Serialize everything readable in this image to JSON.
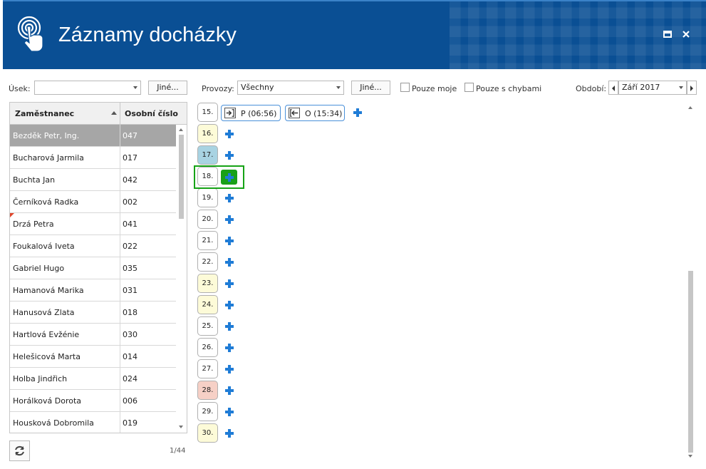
{
  "window": {
    "title": "Záznamy docházky"
  },
  "filters": {
    "usek_label": "Úsek:",
    "usek_value": "",
    "usek_other": "Jiné...",
    "provozy_label": "Provozy:",
    "provozy_value": "Všechny",
    "provozy_other": "Jiné...",
    "only_mine": "Pouze moje",
    "only_errors": "Pouze s chybami",
    "obdobi_label": "Období:",
    "obdobi_value": "Září 2017"
  },
  "grid": {
    "col_employee": "Zaměstnanec",
    "col_number": "Osobní číslo",
    "rows": [
      {
        "name": "Bezděk Petr, Ing.",
        "number": "047",
        "selected": true,
        "flag": false
      },
      {
        "name": "Bucharová Jarmila",
        "number": "017",
        "selected": false,
        "flag": false
      },
      {
        "name": "Buchta Jan",
        "number": "042",
        "selected": false,
        "flag": false
      },
      {
        "name": "Černíková Radka",
        "number": "002",
        "selected": false,
        "flag": false
      },
      {
        "name": "Drzá Petra",
        "number": "041",
        "selected": false,
        "flag": true
      },
      {
        "name": "Foukalová Iveta",
        "number": "022",
        "selected": false,
        "flag": false
      },
      {
        "name": "Gabriel Hugo",
        "number": "035",
        "selected": false,
        "flag": false
      },
      {
        "name": "Hamanová Marika",
        "number": "031",
        "selected": false,
        "flag": false
      },
      {
        "name": "Hanusová Zlata",
        "number": "018",
        "selected": false,
        "flag": false
      },
      {
        "name": "Hartlová Evžénie",
        "number": "030",
        "selected": false,
        "flag": false
      },
      {
        "name": "Helešicová Marta",
        "number": "014",
        "selected": false,
        "flag": false
      },
      {
        "name": "Holba Jindřich",
        "number": "024",
        "selected": false,
        "flag": false
      },
      {
        "name": "Horálková Dorota",
        "number": "006",
        "selected": false,
        "flag": false
      },
      {
        "name": "Housková Dobromila",
        "number": "019",
        "selected": false,
        "flag": false
      }
    ],
    "pager": "1/44"
  },
  "days": [
    {
      "label": "15.",
      "type": "normal"
    },
    {
      "label": "16.",
      "type": "yellow"
    },
    {
      "label": "17.",
      "type": "blue"
    },
    {
      "label": "18.",
      "type": "normal",
      "highlighted": true
    },
    {
      "label": "19.",
      "type": "normal"
    },
    {
      "label": "20.",
      "type": "normal"
    },
    {
      "label": "21.",
      "type": "normal"
    },
    {
      "label": "22.",
      "type": "normal"
    },
    {
      "label": "23.",
      "type": "yellow"
    },
    {
      "label": "24.",
      "type": "yellow"
    },
    {
      "label": "25.",
      "type": "normal"
    },
    {
      "label": "26.",
      "type": "normal"
    },
    {
      "label": "27.",
      "type": "normal"
    },
    {
      "label": "28.",
      "type": "red"
    },
    {
      "label": "29.",
      "type": "normal"
    },
    {
      "label": "30.",
      "type": "yellow"
    }
  ],
  "entries": [
    {
      "label": "P (06:56)",
      "icon": "arrive-icon"
    },
    {
      "label": "O (15:34)",
      "icon": "leave-icon"
    }
  ],
  "colors": {
    "header": "#0a4f94",
    "plus": "#1f7cd6",
    "highlight": "#16a316",
    "selected_row": "#a6a6a6"
  }
}
